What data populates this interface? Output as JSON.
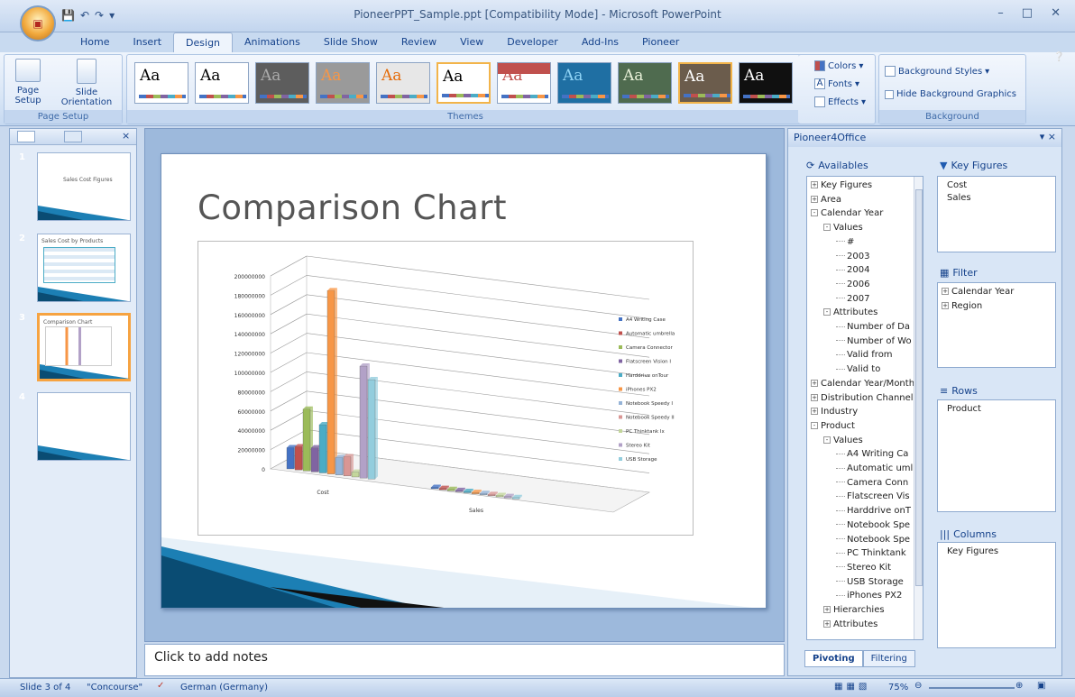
{
  "window": {
    "title": "PioneerPPT_Sample.ppt [Compatibility Mode] - Microsoft PowerPoint"
  },
  "tabs": [
    "Home",
    "Insert",
    "Design",
    "Animations",
    "Slide Show",
    "Review",
    "View",
    "Developer",
    "Add-Ins",
    "Pioneer"
  ],
  "active_tab": "Design",
  "ribbon": {
    "page_setup": {
      "page_setup_label": "Page\nSetup",
      "orientation_label": "Slide\nOrientation",
      "group_label": "Page Setup"
    },
    "themes": {
      "group_label": "Themes",
      "theme_text": "Aa"
    },
    "colors_label": "Colors",
    "fonts_label": "Fonts",
    "effects_label": "Effects",
    "background": {
      "styles_label": "Background Styles",
      "hide_label": "Hide Background Graphics",
      "group_label": "Background"
    }
  },
  "slides_pane": {
    "thumbnails": [
      {
        "num": "1",
        "caption": "Sales Cost Figures"
      },
      {
        "num": "2",
        "caption": "Sales Cost by Products"
      },
      {
        "num": "3",
        "caption": "Comparison Chart"
      },
      {
        "num": "4",
        "caption": ""
      }
    ]
  },
  "slide": {
    "title": "Comparison Chart"
  },
  "chart_data": {
    "type": "bar",
    "categories": [
      "Cost",
      "Sales"
    ],
    "ylim": [
      0,
      200000000
    ],
    "yticks": [
      "200000000",
      "180000000",
      "160000000",
      "140000000",
      "120000000",
      "100000000",
      "80000000",
      "60000000",
      "40000000",
      "20000000",
      "0"
    ],
    "series": [
      {
        "name": "A4 Writing Case",
        "color": "#4472c4",
        "values": [
          22000000,
          0
        ]
      },
      {
        "name": "Automatic umbrella",
        "color": "#c0504d",
        "values": [
          24000000,
          0
        ]
      },
      {
        "name": "Camera Connector",
        "color": "#9bbb59",
        "values": [
          64000000,
          0
        ]
      },
      {
        "name": "Flatscreen Vision I",
        "color": "#8064a2",
        "values": [
          25000000,
          0
        ]
      },
      {
        "name": "Harddrive onTour",
        "color": "#4bacc6",
        "values": [
          50000000,
          0
        ]
      },
      {
        "name": "iPhones PX2",
        "color": "#f79646",
        "values": [
          190000000,
          0
        ]
      },
      {
        "name": "Notebook Speedy I",
        "color": "#95b3d7",
        "values": [
          18000000,
          0
        ]
      },
      {
        "name": "Notebook Speedy II",
        "color": "#d99694",
        "values": [
          20000000,
          0
        ]
      },
      {
        "name": "PC Thinktank Ix",
        "color": "#c3d69b",
        "values": [
          5000000,
          0
        ]
      },
      {
        "name": "Stereo Kit",
        "color": "#b2a1c7",
        "values": [
          116000000,
          0
        ]
      },
      {
        "name": "USB Storage",
        "color": "#93cddd",
        "values": [
          103000000,
          0
        ]
      }
    ]
  },
  "notes": {
    "placeholder": "Click to add notes"
  },
  "pioneer": {
    "title": "Pioneer4Office",
    "availables_label": "Availables",
    "tree": [
      {
        "label": "Key Figures",
        "level": 0,
        "pm": "+"
      },
      {
        "label": "Area",
        "level": 0,
        "pm": "+"
      },
      {
        "label": "Calendar Year",
        "level": 0,
        "pm": "-"
      },
      {
        "label": "Values",
        "level": 1,
        "pm": "-"
      },
      {
        "label": "#",
        "level": 2,
        "pm": ""
      },
      {
        "label": "2003",
        "level": 2,
        "pm": ""
      },
      {
        "label": "2004",
        "level": 2,
        "pm": ""
      },
      {
        "label": "2006",
        "level": 2,
        "pm": ""
      },
      {
        "label": "2007",
        "level": 2,
        "pm": ""
      },
      {
        "label": "Attributes",
        "level": 1,
        "pm": "-"
      },
      {
        "label": "Number of Da",
        "level": 2,
        "pm": ""
      },
      {
        "label": "Number of Wo",
        "level": 2,
        "pm": ""
      },
      {
        "label": "Valid from",
        "level": 2,
        "pm": ""
      },
      {
        "label": "Valid to",
        "level": 2,
        "pm": ""
      },
      {
        "label": "Calendar Year/Month",
        "level": 0,
        "pm": "+"
      },
      {
        "label": "Distribution Channel",
        "level": 0,
        "pm": "+"
      },
      {
        "label": "Industry",
        "level": 0,
        "pm": "+"
      },
      {
        "label": "Product",
        "level": 0,
        "pm": "-"
      },
      {
        "label": "Values",
        "level": 1,
        "pm": "-"
      },
      {
        "label": "A4 Writing Ca",
        "level": 2,
        "pm": ""
      },
      {
        "label": "Automatic uml",
        "level": 2,
        "pm": ""
      },
      {
        "label": "Camera Conn",
        "level": 2,
        "pm": ""
      },
      {
        "label": "Flatscreen Vis",
        "level": 2,
        "pm": ""
      },
      {
        "label": "Harddrive onT",
        "level": 2,
        "pm": ""
      },
      {
        "label": "Notebook Spe",
        "level": 2,
        "pm": ""
      },
      {
        "label": "Notebook Spe",
        "level": 2,
        "pm": ""
      },
      {
        "label": "PC Thinktank",
        "level": 2,
        "pm": ""
      },
      {
        "label": "Stereo Kit",
        "level": 2,
        "pm": ""
      },
      {
        "label": "USB Storage",
        "level": 2,
        "pm": ""
      },
      {
        "label": "iPhones PX2",
        "level": 2,
        "pm": ""
      },
      {
        "label": "Hierarchies",
        "level": 1,
        "pm": "+"
      },
      {
        "label": "Attributes",
        "level": 1,
        "pm": "+"
      }
    ],
    "key_figures": {
      "label": "Key Figures",
      "items": [
        "Cost",
        "Sales"
      ]
    },
    "filter": {
      "label": "Filter",
      "items": [
        "Calendar Year",
        "Region"
      ]
    },
    "rows": {
      "label": "Rows",
      "items": [
        "Product"
      ]
    },
    "columns": {
      "label": "Columns",
      "items": [
        "Key Figures"
      ]
    },
    "tabs": [
      "Pivoting",
      "Filtering"
    ]
  },
  "status": {
    "slide_info": "Slide 3 of 4",
    "theme": "\"Concourse\"",
    "language": "German (Germany)",
    "zoom": "75%"
  }
}
